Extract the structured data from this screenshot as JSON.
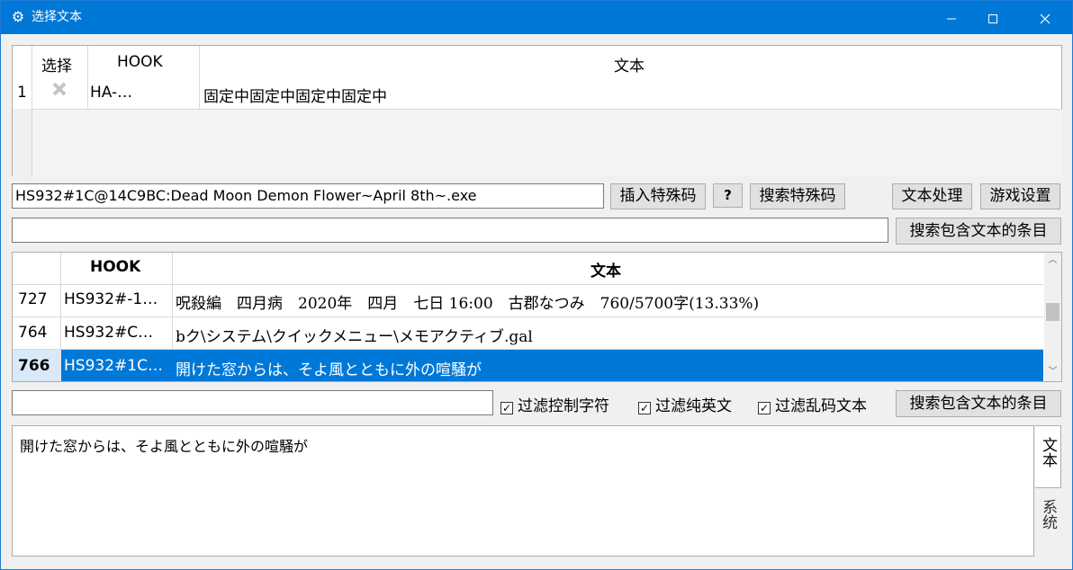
{
  "window": {
    "title": "选择文本",
    "icons": {
      "app": "gear-icon",
      "minimize": "minimize-icon",
      "maximize": "maximize-icon",
      "close": "close-icon"
    }
  },
  "top_table": {
    "headers": {
      "select": "选择",
      "hook": "HOOK",
      "text": "文本"
    },
    "rows": [
      {
        "num": "1",
        "select_icon": "x-icon",
        "hook": "HA-…",
        "text": "固定中固定中固定中固定中"
      }
    ]
  },
  "hook_input": {
    "value": "HS932#1C@14C9BC:Dead Moon Demon Flower~April 8th~.exe"
  },
  "buttons": {
    "insert_special": "插入特殊码",
    "help": "?",
    "search_special": "搜索特殊码",
    "text_process": "文本处理",
    "game_settings": "游戏设置",
    "search_entries_1": "搜索包含文本的条目",
    "search_entries_2": "搜索包含文本的条目"
  },
  "search_input_1": {
    "value": ""
  },
  "main_table": {
    "headers": {
      "hook": "HOOK",
      "text": "文本"
    },
    "rows": [
      {
        "num": "727",
        "hook": "HS932#-1…",
        "text": "呪殺編　四月病　2020年　四月　七日 16:00　古郡なつみ　760/5700字(13.33%)"
      },
      {
        "num": "764",
        "hook": "HS932#C…",
        "text": "bク\\システム\\クイックメニュー\\メモアクティブ.gal"
      },
      {
        "num": "766",
        "hook": "HS932#1C…",
        "text": "開けた窓からは、そよ風とともに外の喧騒が",
        "selected": true
      }
    ]
  },
  "filter_input": {
    "value": ""
  },
  "filters": {
    "control_chars": {
      "label": "过滤控制字符",
      "checked": true
    },
    "pure_english": {
      "label": "过滤纯英文",
      "checked": true
    },
    "garbled": {
      "label": "过滤乱码文本",
      "checked": true
    }
  },
  "text_area": {
    "value": "開けた窓からは、そよ風とともに外の喧騒が"
  },
  "side_tabs": {
    "text": "文本",
    "system": "系统"
  }
}
